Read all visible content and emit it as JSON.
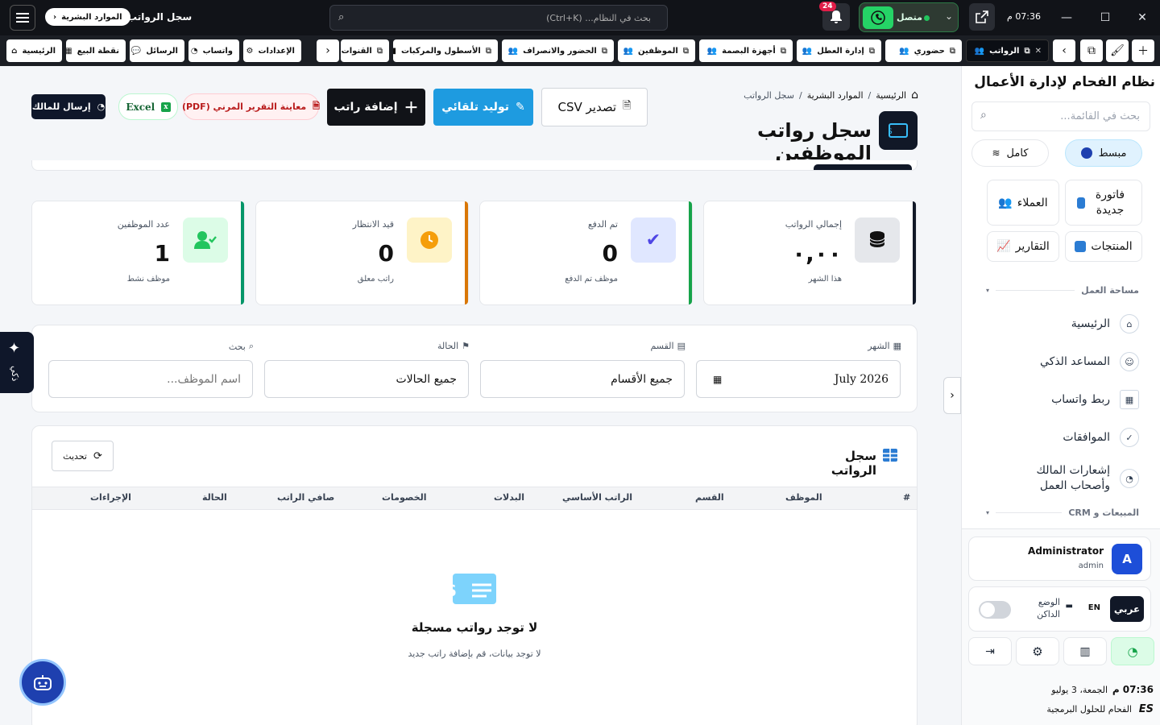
{
  "topbar": {
    "menu_icon": "hamburger-icon",
    "breadcrumb_parent": "الموارد البشرية",
    "page_name": "سجل الرواتب",
    "search_placeholder": "بحث في النظام... (Ctrl+K)",
    "notifications_count": "24",
    "whatsapp_status": "متصل",
    "time": "07:36 م"
  },
  "tabs": {
    "items": [
      {
        "label": "الرواتب",
        "active": true
      },
      {
        "label": "حضوري"
      },
      {
        "label": "إدارة العطل"
      },
      {
        "label": "أجهزة البصمة"
      },
      {
        "label": "الموظفين"
      },
      {
        "label": "الحضور والانصراف"
      },
      {
        "label": "الأسطول والمركبات"
      },
      {
        "label": "القنوات"
      }
    ],
    "shortcuts": [
      {
        "label": "الإعدادات"
      },
      {
        "label": "واتساب"
      },
      {
        "label": "الرسائل"
      },
      {
        "label": "نقطة البيع"
      },
      {
        "label": "الرئيسية"
      }
    ]
  },
  "header": {
    "breadcrumb": [
      "الرئيسية",
      "الموارد البشرية",
      "سجل الرواتب"
    ],
    "title": "سجل رواتب الموظفين",
    "actions": {
      "export_csv": "تصدير CSV",
      "auto_generate": "توليد تلقائي",
      "add_salary": "إضافة راتب",
      "pdf_preview": "معاينة التقرير المرني (PDF)",
      "excel": "Excel",
      "send_owner": "إرسال للمالك"
    }
  },
  "stats": [
    {
      "label": "إجمالي الرواتب",
      "value": "٠,٠٠",
      "sub": "هذا الشهر",
      "color": "#111827"
    },
    {
      "label": "تم الدفع",
      "value": "0",
      "sub": "موظف تم الدفع",
      "color": "#16a34a"
    },
    {
      "label": "قيد الانتظار",
      "value": "0",
      "sub": "راتب معلق",
      "color": "#d97706"
    },
    {
      "label": "عدد الموظفين",
      "value": "1",
      "sub": "موظف نشط",
      "color": "#059669"
    }
  ],
  "filters": {
    "month_label": "الشهر",
    "month_value": "July 2026",
    "department_label": "القسم",
    "department_value": "جميع الأقسام",
    "status_label": "الحالة",
    "status_value": "جميع الحالات",
    "search_label": "بحث",
    "search_placeholder": "اسم الموظف..."
  },
  "table": {
    "title": "سجل الرواتب",
    "refresh": "تحديث",
    "columns": [
      "#",
      "الموظف",
      "القسم",
      "الراتب الأساسي",
      "البدلات",
      "الخصومات",
      "صافي الراتب",
      "الحالة",
      "الإجراءات"
    ],
    "empty_title": "لا توجد رواتب مسجلة",
    "empty_sub": "لا توجد بيانات، قم بإضافة راتب جديد"
  },
  "side_tab": {
    "label": "ذكي"
  },
  "sidebar": {
    "app_title": "نظام الفحام لإدارة الأعمال",
    "search_placeholder": "بحث في القائمة...",
    "mode_simple": "مبسط",
    "mode_full": "كامل",
    "quick": [
      {
        "label": "فاتورة جديدة"
      },
      {
        "label": "العملاء"
      },
      {
        "label": "المنتجات"
      },
      {
        "label": "التقارير"
      }
    ],
    "section_workspace": "مساحة العمل",
    "menu": [
      {
        "label": "الرئيسية"
      },
      {
        "label": "المساعد الذكي"
      },
      {
        "label": "ربط واتساب"
      },
      {
        "label": "الموافقات"
      },
      {
        "label": "إشعارات المالك وأصحاب العمل"
      }
    ],
    "section_sales": "المبيعات و CRM",
    "user_name": "Administrator",
    "user_role": "admin",
    "user_initial": "A",
    "lang_ar": "عربي",
    "lang_en": "EN",
    "dark_mode": "الوضع الداكن",
    "clock_time": "07:36 م",
    "clock_date": "الجمعة، 3 يوليو",
    "company": "الفحام للحلول البرمجية",
    "company_logo": "ES"
  },
  "colors": {
    "primary_blue": "#1e9be0",
    "dark": "#111318",
    "green": "#25d366"
  }
}
